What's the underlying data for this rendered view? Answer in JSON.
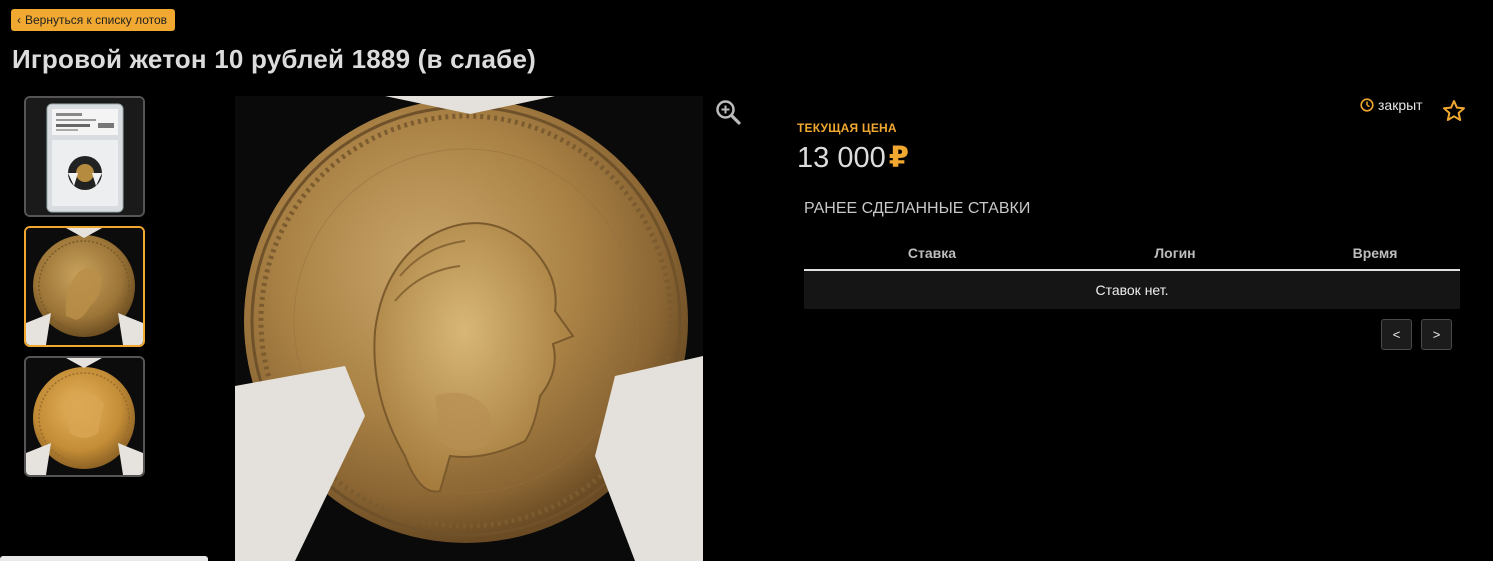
{
  "nav": {
    "back_label": "Вернуться к списку лотов"
  },
  "lot": {
    "title": "Игровой жетон 10 рублей 1889 (в слабе)",
    "status": "закрыт"
  },
  "price": {
    "label": "ТЕКУЩАЯ ЦЕНА",
    "value": "13 000",
    "currency": "₽"
  },
  "bids": {
    "heading": "РАНЕЕ СДЕЛАННЫЕ СТАВКИ",
    "columns": [
      "Ставка",
      "Логин",
      "Время"
    ],
    "empty_text": "Ставок нет."
  },
  "pagination": {
    "prev_label": "<",
    "next_label": ">"
  },
  "colors": {
    "accent": "#f0a830",
    "background": "#000000"
  },
  "icons": {
    "back": "chevron-left-icon",
    "zoom": "zoom-in-icon",
    "status": "clock-icon",
    "favorite": "star-outline-icon"
  }
}
